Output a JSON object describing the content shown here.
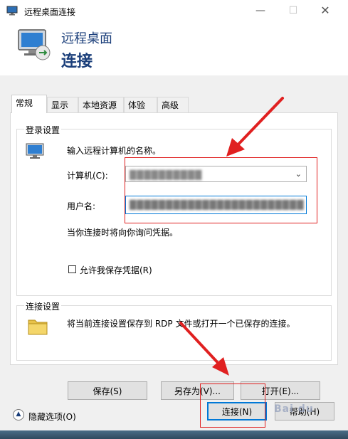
{
  "window": {
    "title": "远程桌面连接",
    "minimize": "—",
    "maximize": "☐",
    "close": "✕"
  },
  "banner": {
    "subtitle": "远程桌面",
    "title": "连接"
  },
  "tabs": [
    {
      "label": "常规",
      "active": true
    },
    {
      "label": "显示",
      "active": false
    },
    {
      "label": "本地资源",
      "active": false
    },
    {
      "label": "体验",
      "active": false
    },
    {
      "label": "高级",
      "active": false
    }
  ],
  "login": {
    "group_title": "登录设置",
    "prompt": "输入远程计算机的名称。",
    "computer_label": "计算机(C):",
    "computer_value": "██████████",
    "username_label": "用户名:",
    "username_value": "████████████████████████",
    "hint": "当你连接时将向你询问凭据。",
    "save_credentials_label": "允许我保存凭据(R)",
    "save_credentials_checked": false
  },
  "connection": {
    "group_title": "连接设置",
    "description": "将当前连接设置保存到 RDP 文件或打开一个已保存的连接。",
    "save_button": "保存(S)",
    "save_as_button": "另存为(V)...",
    "open_button": "打开(E)..."
  },
  "footer": {
    "hide_options": "隐藏选项(O)",
    "connect_button": "连接(N)",
    "help_button": "帮助(H)"
  },
  "watermark": "Bai du",
  "colors": {
    "title_blue": "#1a3e7a",
    "annotation_red": "#e02020",
    "focus_blue": "#0078d7"
  }
}
